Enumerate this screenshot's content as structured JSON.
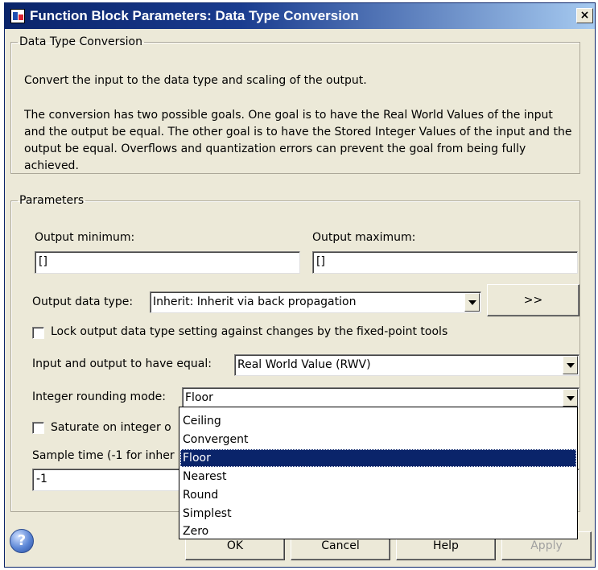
{
  "window": {
    "title": "Function Block Parameters: Data Type Conversion",
    "close_label": "×"
  },
  "description": {
    "group_label": "Data Type Conversion",
    "line1": "Convert the input to the data type and scaling of the output.",
    "paragraph": "The conversion has two possible goals. One goal is to have the Real World Values of the input and the output be equal.  The other goal is to have the Stored Integer Values of the input and the output be equal.  Overflows and quantization errors can prevent the goal from being fully achieved."
  },
  "parameters": {
    "group_label": "Parameters",
    "output_minimum_label": "Output minimum:",
    "output_minimum_value": "[]",
    "output_maximum_label": "Output maximum:",
    "output_maximum_value": "[]",
    "output_data_type_label": "Output data type:",
    "output_data_type_value": "Inherit: Inherit via back propagation",
    "assistant_button_label": ">>",
    "lock_label": "Lock output data type setting against changes by the fixed-point tools",
    "equal_label": "Input and output to have equal:",
    "equal_value": "Real World Value (RWV)",
    "rounding_label": "Integer rounding mode:",
    "rounding_value": "Floor",
    "saturate_label": "Saturate on integer o",
    "sample_time_label": "Sample time (-1 for inher",
    "sample_time_value": "-1"
  },
  "rounding_options": [
    "Ceiling",
    "Convergent",
    "Floor",
    "Nearest",
    "Round",
    "Simplest",
    "Zero"
  ],
  "rounding_selected": "Floor",
  "buttons": {
    "ok": "OK",
    "cancel": "Cancel",
    "help": "Help",
    "apply": "Apply",
    "help_icon": "?"
  },
  "colors": {
    "selection": "#0a246a",
    "titlebar": "#0a246a",
    "face": "#ece9d8"
  }
}
